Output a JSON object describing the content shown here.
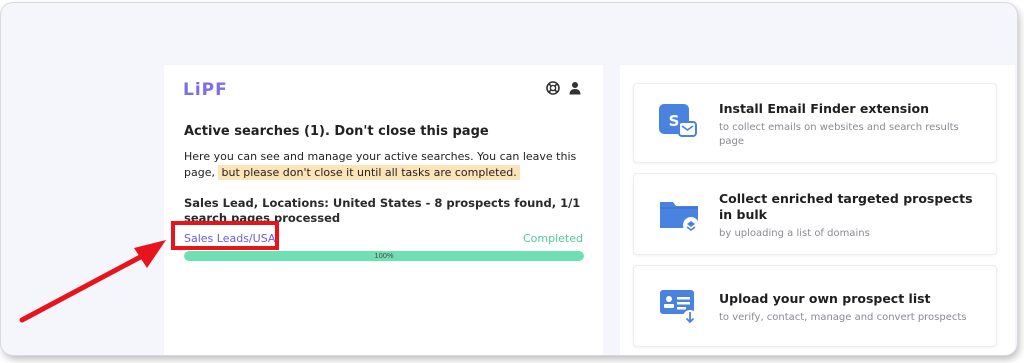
{
  "brand": {
    "logo_text": "LiPF"
  },
  "header_icons": [
    "lifebuoy-icon",
    "user-icon"
  ],
  "active_searches": {
    "title": "Active searches (1). Don't close this page",
    "desc_part1": "Here you can see and manage your active searches. You can leave this page,",
    "desc_highlight": "but please don't close it until all tasks are completed."
  },
  "search_item": {
    "summary": "Sales Lead, Locations: United States - 8 prospects found, 1/1 search pages processed",
    "link_label": "Sales Leads/USA",
    "status": "Completed",
    "progress_percent": 100,
    "progress_label": "100%"
  },
  "cards": [
    {
      "icon": "email-finder-extension-icon",
      "title": "Install Email Finder extension",
      "subtitle": "to collect emails on websites and search results page"
    },
    {
      "icon": "folder-upload-icon",
      "title": "Collect enriched targeted prospects in bulk",
      "subtitle": "by uploading a list of domains"
    },
    {
      "icon": "contact-list-upload-icon",
      "title": "Upload your own prospect list",
      "subtitle": "to verify, contact, manage and convert prospects"
    }
  ],
  "colors": {
    "brand": "#7b6ee8",
    "completed": "#53c79a",
    "progress": "#6fe0b3",
    "highlight": "#fce3b8",
    "annotation": "#e8141c",
    "icon_blue": "#4a82e0"
  }
}
